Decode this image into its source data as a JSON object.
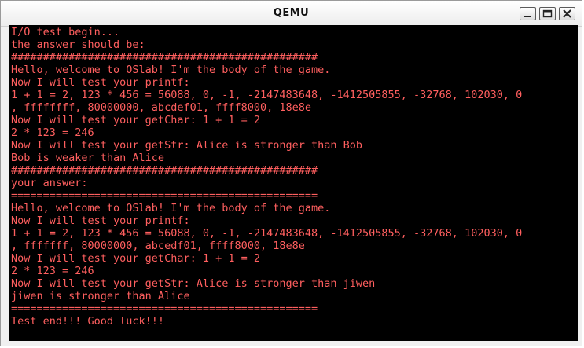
{
  "window": {
    "title": "QEMU"
  },
  "icons": {
    "minimize": "minimize-icon",
    "maximize": "maximize-icon",
    "close": "close-icon"
  },
  "colors": {
    "console_text": "#ff5f5f",
    "console_bg": "#000000"
  },
  "console": {
    "lines": [
      "I/O test begin...",
      "the answer should be:",
      "################################################",
      "Hello, welcome to OSlab! I'm the body of the game.",
      "Now I will test your printf:",
      "1 + 1 = 2, 123 * 456 = 56088, 0, -1, -2147483648, -1412505855, -32768, 102030, 0",
      ", ffffffff, 80000000, abcdef01, ffff8000, 18e8e",
      "Now I will test your getChar: 1 + 1 = 2",
      "2 * 123 = 246",
      "Now I will test your getStr: Alice is stronger than Bob",
      "Bob is weaker than Alice",
      "################################################",
      "your answer:",
      "================================================",
      "Hello, welcome to OSlab! I'm the body of the game.",
      "Now I will test your printf:",
      "1 + 1 = 2, 123 * 456 = 56088, 0, -1, -2147483648, -1412505855, -32768, 102030, 0",
      ", fffffff, 80000000, abcedf01, ffff8000, 18e8e",
      "Now I will test your getChar: 1 + 1 = 2",
      "2 * 123 = 246",
      "Now I will test your getStr: Alice is stronger than jiwen",
      "jiwen is stronger than Alice",
      "================================================",
      "Test end!!! Good luck!!!"
    ]
  }
}
